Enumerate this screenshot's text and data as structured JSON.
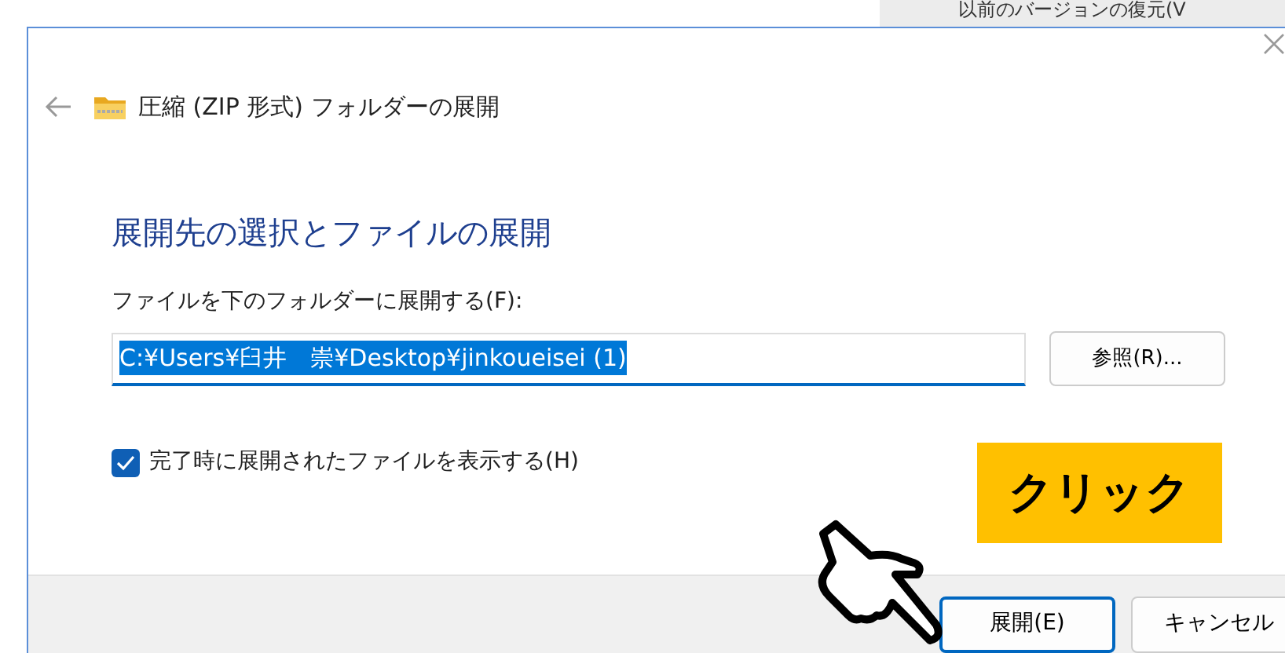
{
  "background_menu_item": "以前のバージョンの復元(V",
  "dialog": {
    "title": "圧縮 (ZIP 形式) フォルダーの展開",
    "heading": "展開先の選択とファイルの展開",
    "destination": {
      "label": "ファイルを下のフォルダーに展開する(F):",
      "value": "C:¥Users¥臼井　崇¥Desktop¥jinkoueisei (1)"
    },
    "browse_button": "参照(R)...",
    "show_files": {
      "label": "完了時に展開されたファイルを表示する(H)",
      "checked": true
    },
    "buttons": [
      {
        "label": "展開(E)",
        "selected": true
      },
      {
        "label": "キャンセル",
        "selected": false
      }
    ]
  },
  "callout": "クリック"
}
